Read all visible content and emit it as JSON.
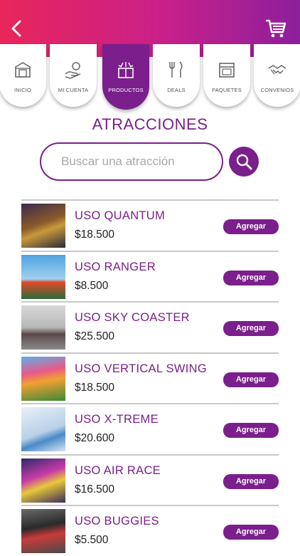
{
  "header": {
    "back_icon": "chevron-left-icon",
    "cart_icon": "shopping-cart-icon"
  },
  "tabs": [
    {
      "label": "INICIO",
      "icon": "store-icon",
      "active": false
    },
    {
      "label": "MI CUENTA",
      "icon": "hand-coin-icon",
      "active": false
    },
    {
      "label": "PRODUCTOS",
      "icon": "gift-box-icon",
      "active": true
    },
    {
      "label": "DEALS",
      "icon": "cutlery-icon",
      "active": false
    },
    {
      "label": "PAQUETES",
      "icon": "storefront-icon",
      "active": false
    },
    {
      "label": "CONVENIOS",
      "icon": "handshake-icon",
      "active": false
    }
  ],
  "section": {
    "title": "ATRACCIONES"
  },
  "search": {
    "placeholder": "Buscar una atracción",
    "button_icon": "search-icon"
  },
  "add_label": "Agregar",
  "items": [
    {
      "name": "USO QUANTUM",
      "price": "$18.500"
    },
    {
      "name": "USO RANGER",
      "price": "$8.500"
    },
    {
      "name": "USO SKY COASTER",
      "price": "$25.500"
    },
    {
      "name": "USO VERTICAL SWING",
      "price": "$18.500"
    },
    {
      "name": "USO X-TREME",
      "price": "$20.600"
    },
    {
      "name": "USO AIR RACE",
      "price": "$16.500"
    },
    {
      "name": "USO BUGGIES",
      "price": "$5.500"
    }
  ],
  "colors": {
    "primary": "#7a1f8c",
    "gradient_start": "#e8265a",
    "gradient_end": "#8c1f9c"
  }
}
